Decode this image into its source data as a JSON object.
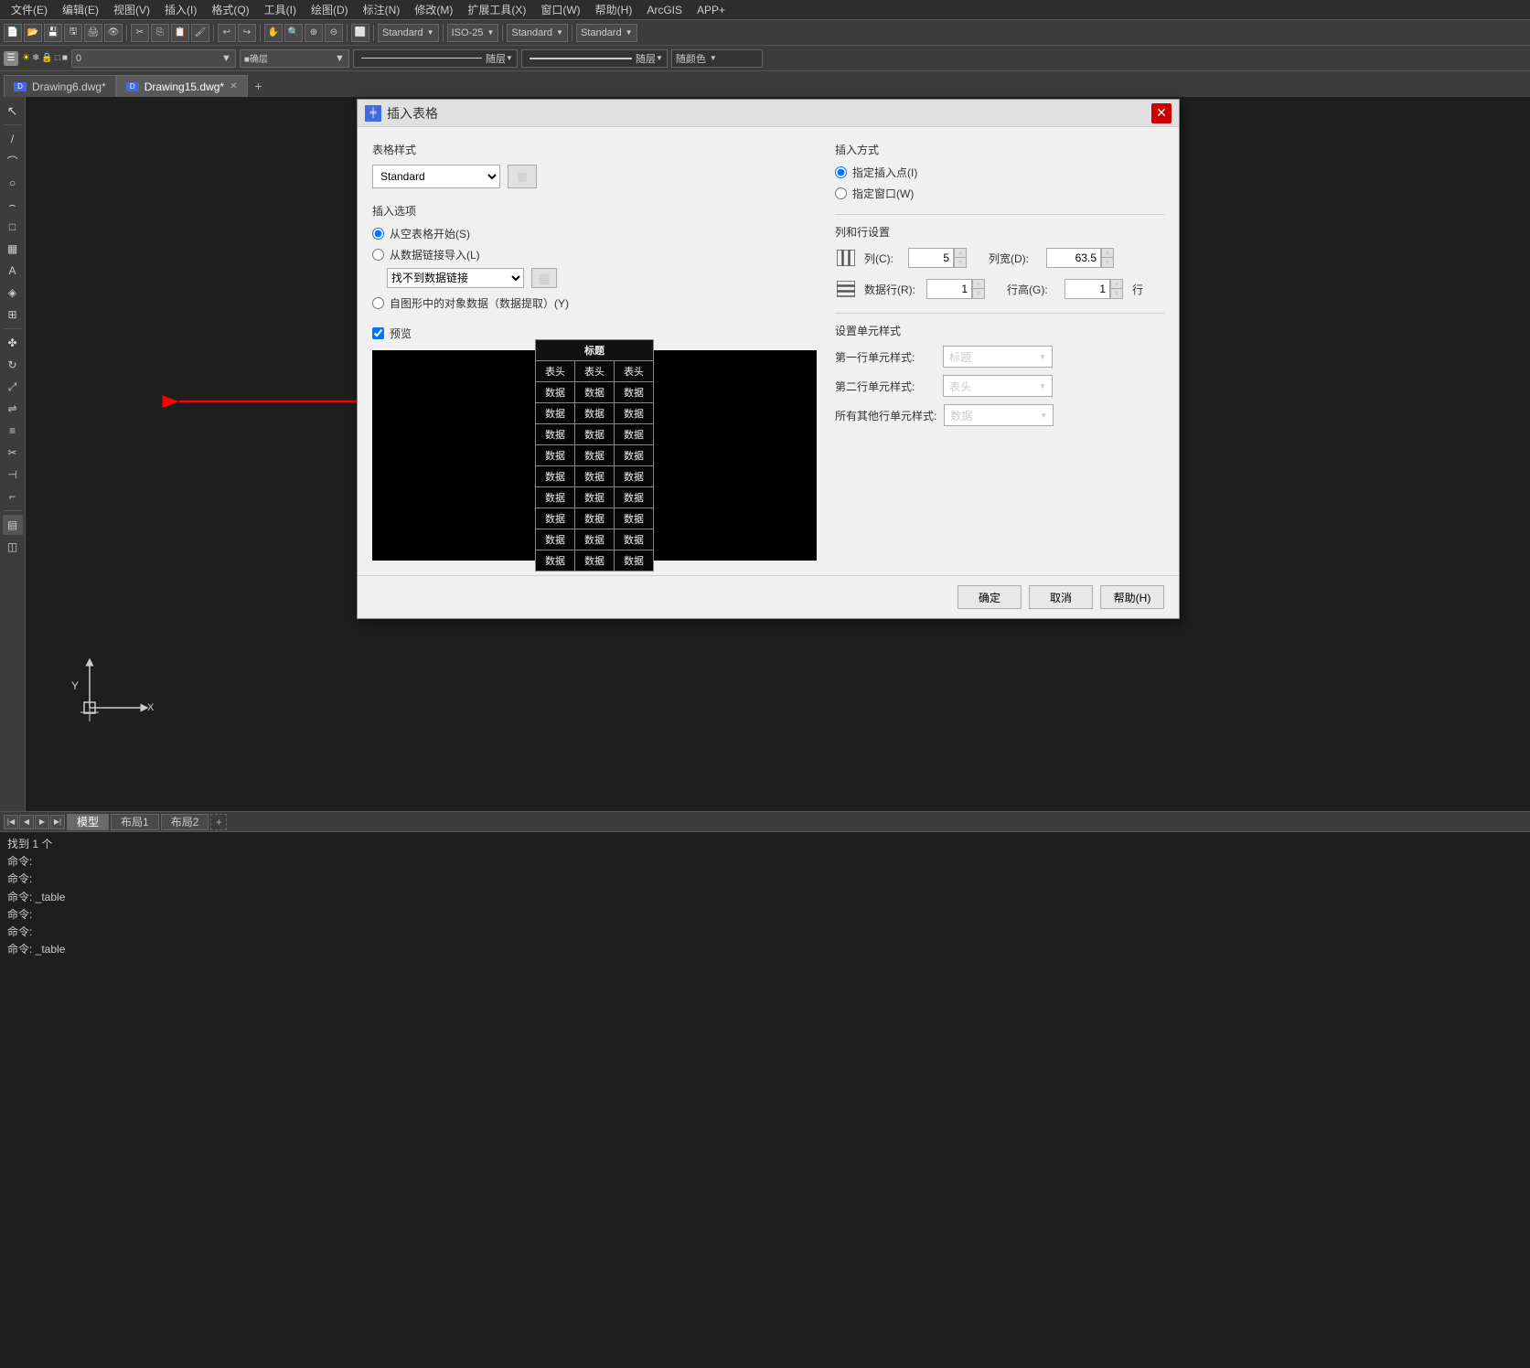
{
  "menubar": {
    "items": [
      "文件(E)",
      "编辑(E)",
      "视图(V)",
      "插入(I)",
      "格式(Q)",
      "工具(I)",
      "绘图(D)",
      "标注(N)",
      "修改(M)",
      "扩展工具(X)",
      "窗口(W)",
      "帮助(H)",
      "ArcGIS",
      "APP+"
    ]
  },
  "tabs": {
    "items": [
      {
        "label": "Drawing6.dwg*",
        "active": false
      },
      {
        "label": "Drawing15.dwg*",
        "active": true
      }
    ],
    "add_icon": "+"
  },
  "toolbar": {
    "standard_label": "Standard",
    "iso25_label": "ISO-25",
    "standard2_label": "Standard",
    "standard3_label": "Standard"
  },
  "layer": {
    "value": "0",
    "随层_label": "随层",
    "随层2_label": "随层",
    "随颜色_label": "随颜色"
  },
  "bottom_tabs": {
    "model_label": "模型",
    "layout1_label": "布局1",
    "layout2_label": "布局2"
  },
  "command_lines": [
    "找到 1 个",
    "命令:",
    "命令:",
    "命令: _table",
    "命令:",
    "命令:",
    "命令: _table"
  ],
  "dialog": {
    "title": "插入表格",
    "icon": "╪",
    "close_icon": "✕",
    "table_style_label": "表格样式",
    "style_value": "Standard",
    "style_btn_icon": "▦",
    "insert_options_label": "插入选项",
    "radio_blank": "从空表格开始(S)",
    "radio_datalink": "从数据链接导入(L)",
    "datalink_placeholder": "找不到数据链接",
    "radio_object_data": "自图形中的对象数据（数据提取）(Y)",
    "preview_label": "预览",
    "preview_checked": true,
    "preview_table": {
      "title": "标题",
      "headers": [
        "表头",
        "表头",
        "表头"
      ],
      "data_rows": [
        [
          "数据",
          "数据",
          "数据"
        ],
        [
          "数据",
          "数据",
          "数据"
        ],
        [
          "数据",
          "数据",
          "数据"
        ],
        [
          "数据",
          "数据",
          "数据"
        ],
        [
          "数据",
          "数据",
          "数据"
        ],
        [
          "数据",
          "数据",
          "数据"
        ],
        [
          "数据",
          "数据",
          "数据"
        ],
        [
          "数据",
          "数据",
          "数据"
        ],
        [
          "数据",
          "数据",
          "数据"
        ]
      ]
    },
    "insert_method_label": "插入方式",
    "radio_point": "指定插入点(I)",
    "radio_window": "指定窗口(W)",
    "row_col_label": "列和行设置",
    "col_label": "列(C):",
    "col_value": "5",
    "col_width_label": "列宽(D):",
    "col_width_value": "63.5",
    "data_row_label": "数据行(R):",
    "data_row_value": "1",
    "row_height_label": "行高(G):",
    "row_height_value": "1",
    "row_height_unit": "行",
    "cell_style_label": "设置单元样式",
    "first_row_label": "第一行单元样式:",
    "first_row_value": "标题",
    "second_row_label": "第二行单元样式:",
    "second_row_value": "表头",
    "other_rows_label": "所有其他行单元样式:",
    "other_rows_value": "数据",
    "btn_ok": "确定",
    "btn_cancel": "取消",
    "btn_help": "帮助(H)"
  }
}
